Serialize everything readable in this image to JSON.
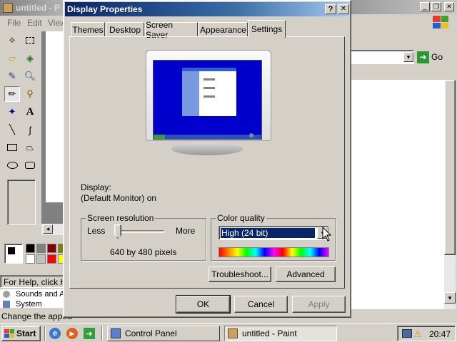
{
  "paint": {
    "title": "untitled - P",
    "menu": [
      "File",
      "Edit",
      "View"
    ],
    "status": "For Help, click He"
  },
  "right_window": {
    "go_label": "Go"
  },
  "control_panel_bits": {
    "item1": "Sounds and A",
    "item2": "System",
    "status": "Change the appea"
  },
  "dialog": {
    "title": "Display Properties",
    "help_btn": "?",
    "close_btn": "✕",
    "tabs": [
      "Themes",
      "Desktop",
      "Screen Saver",
      "Appearance",
      "Settings"
    ],
    "active_tab": "Settings",
    "display_label": "Display:",
    "display_value": "(Default Monitor) on",
    "resolution": {
      "title": "Screen resolution",
      "less": "Less",
      "more": "More",
      "value_text": "640 by 480 pixels",
      "slider_level": 0
    },
    "color": {
      "title": "Color quality",
      "selected": "High (24 bit)"
    },
    "troubleshoot": "Troubleshoot...",
    "advanced": "Advanced",
    "ok": "OK",
    "cancel": "Cancel",
    "apply": "Apply"
  },
  "taskbar": {
    "start": "Start",
    "tasks": [
      "Control Panel",
      "untitled - Paint"
    ],
    "time": "20:47"
  },
  "colors": {
    "xp_blue": "#0000cc",
    "dialog_title": "#0a246a",
    "face": "#d4d0c8"
  }
}
